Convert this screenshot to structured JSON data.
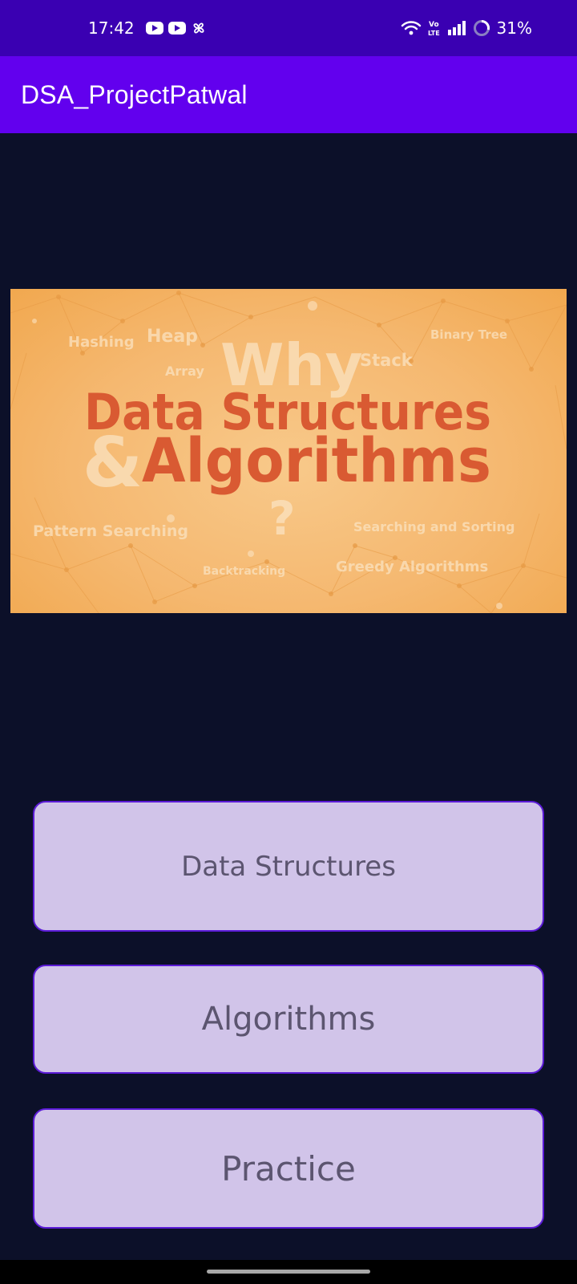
{
  "status_bar": {
    "time": "17:42",
    "left_icons": [
      "youtube-icon",
      "youtube-icon",
      "pinwheel-icon"
    ],
    "right_icons": [
      "wifi-icon",
      "volte-icon",
      "signal-icon",
      "battery-ring-icon"
    ],
    "battery_percent": "31%",
    "volte_top": "Vo",
    "volte_bottom": "LTE",
    "color": "#3a00b2"
  },
  "app_bar": {
    "title": "DSA_ProjectPatwal",
    "color": "#6200ee"
  },
  "banner": {
    "line_why": "Why",
    "line_ds": "Data Structures",
    "ampersand": "&",
    "line_algo": "Algorithms",
    "question": "?",
    "bg_words": {
      "hashing": "Hashing",
      "heap": "Heap",
      "array": "Array",
      "stack": "Stack",
      "binary_tree": "Binary Tree",
      "pattern_searching": "Pattern Searching",
      "searching_sorting": "Searching and Sorting",
      "backtracking": "Backtracking",
      "greedy": "Greedy Algorithms"
    },
    "accent": "#d95a32"
  },
  "buttons": {
    "data_structures": "Data Structures",
    "algorithms": "Algorithms",
    "practice": "Practice"
  },
  "colors": {
    "background": "#0c1029",
    "button_fill": "#d1c4e9",
    "button_border": "#5b1bd6",
    "button_text": "#5c5570"
  }
}
